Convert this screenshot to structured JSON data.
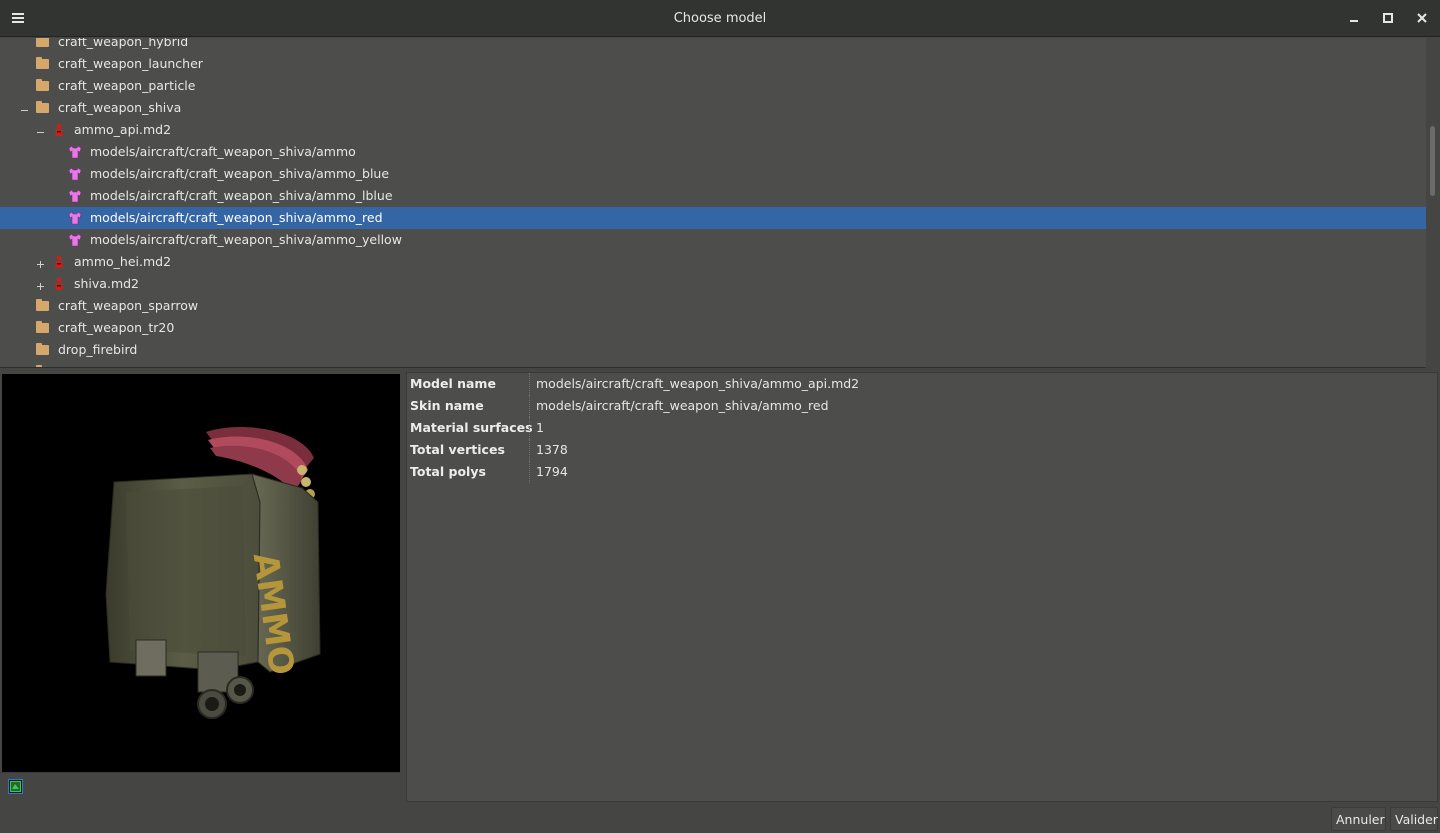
{
  "window": {
    "title": "Choose model",
    "menu_icon": "hamburger-menu-icon",
    "minimize_icon": "minimize-icon",
    "maximize_icon": "maximize-icon",
    "close_icon": "close-icon"
  },
  "tree": {
    "items": [
      {
        "label": "craft_weapon_hybrid",
        "kind": "folder",
        "depth": 0,
        "expander": "none",
        "selected": false
      },
      {
        "label": "craft_weapon_launcher",
        "kind": "folder",
        "depth": 0,
        "expander": "none",
        "selected": false
      },
      {
        "label": "craft_weapon_particle",
        "kind": "folder",
        "depth": 0,
        "expander": "none",
        "selected": false
      },
      {
        "label": "craft_weapon_shiva",
        "kind": "folder",
        "depth": 0,
        "expander": "minus",
        "selected": false
      },
      {
        "label": "ammo_api.md2",
        "kind": "model",
        "depth": 1,
        "expander": "minus",
        "selected": false
      },
      {
        "label": "models/aircraft/craft_weapon_shiva/ammo",
        "kind": "skin",
        "depth": 2,
        "expander": "none",
        "selected": false
      },
      {
        "label": "models/aircraft/craft_weapon_shiva/ammo_blue",
        "kind": "skin",
        "depth": 2,
        "expander": "none",
        "selected": false
      },
      {
        "label": "models/aircraft/craft_weapon_shiva/ammo_lblue",
        "kind": "skin",
        "depth": 2,
        "expander": "none",
        "selected": false
      },
      {
        "label": "models/aircraft/craft_weapon_shiva/ammo_red",
        "kind": "skin",
        "depth": 2,
        "expander": "none",
        "selected": true
      },
      {
        "label": "models/aircraft/craft_weapon_shiva/ammo_yellow",
        "kind": "skin",
        "depth": 2,
        "expander": "none",
        "selected": false
      },
      {
        "label": "ammo_hei.md2",
        "kind": "model",
        "depth": 1,
        "expander": "plus",
        "selected": false
      },
      {
        "label": "shiva.md2",
        "kind": "model",
        "depth": 1,
        "expander": "plus",
        "selected": false
      },
      {
        "label": "craft_weapon_sparrow",
        "kind": "folder",
        "depth": 0,
        "expander": "none",
        "selected": false
      },
      {
        "label": "craft_weapon_tr20",
        "kind": "folder",
        "depth": 0,
        "expander": "none",
        "selected": false
      },
      {
        "label": "drop_firebird",
        "kind": "folder",
        "depth": 0,
        "expander": "none",
        "selected": false
      },
      {
        "label": "",
        "kind": "folder",
        "depth": 0,
        "expander": "none",
        "selected": false
      }
    ]
  },
  "preview": {
    "box_label": "AMMO",
    "toggle_icon": "view-mode-icon"
  },
  "info": {
    "rows": [
      {
        "key": "Model name",
        "value": "models/aircraft/craft_weapon_shiva/ammo_api.md2"
      },
      {
        "key": "Skin name",
        "value": "models/aircraft/craft_weapon_shiva/ammo_red"
      },
      {
        "key": "Material surfaces",
        "value": "1"
      },
      {
        "key": "Total vertices",
        "value": "1378"
      },
      {
        "key": "Total polys",
        "value": "1794"
      }
    ]
  },
  "footer": {
    "cancel_label": "Annuler",
    "ok_label": "Valider"
  },
  "colors": {
    "selection": "#3465a4",
    "folder": "#d6a76a",
    "model_icon": "#c0241c",
    "skin_icon": "#e878e8"
  }
}
